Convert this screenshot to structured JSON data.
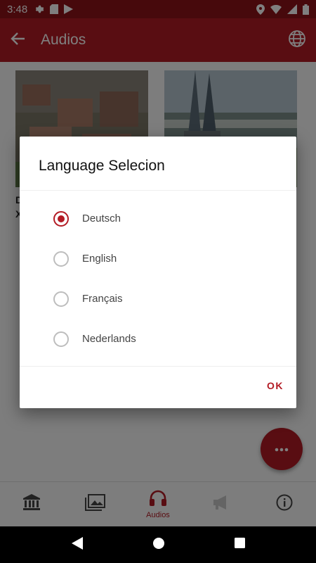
{
  "status_bar": {
    "time": "3:48"
  },
  "app_bar": {
    "title": "Audios"
  },
  "content": {
    "card_title_partial": "D\nX"
  },
  "bottom_nav": {
    "items": [
      {
        "icon": "museum-icon",
        "label": ""
      },
      {
        "icon": "gallery-icon",
        "label": ""
      },
      {
        "icon": "headphones-icon",
        "label": "Audios"
      },
      {
        "icon": "megaphone-icon",
        "label": ""
      },
      {
        "icon": "info-icon",
        "label": ""
      }
    ]
  },
  "dialog": {
    "title": "Language Selecion",
    "options": [
      {
        "label": "Deutsch",
        "selected": true
      },
      {
        "label": "English",
        "selected": false
      },
      {
        "label": "Français",
        "selected": false
      },
      {
        "label": "Nederlands",
        "selected": false
      }
    ],
    "ok_label": "OK"
  },
  "colors": {
    "primary": "#b31b24",
    "status_bar": "#8f1219"
  }
}
